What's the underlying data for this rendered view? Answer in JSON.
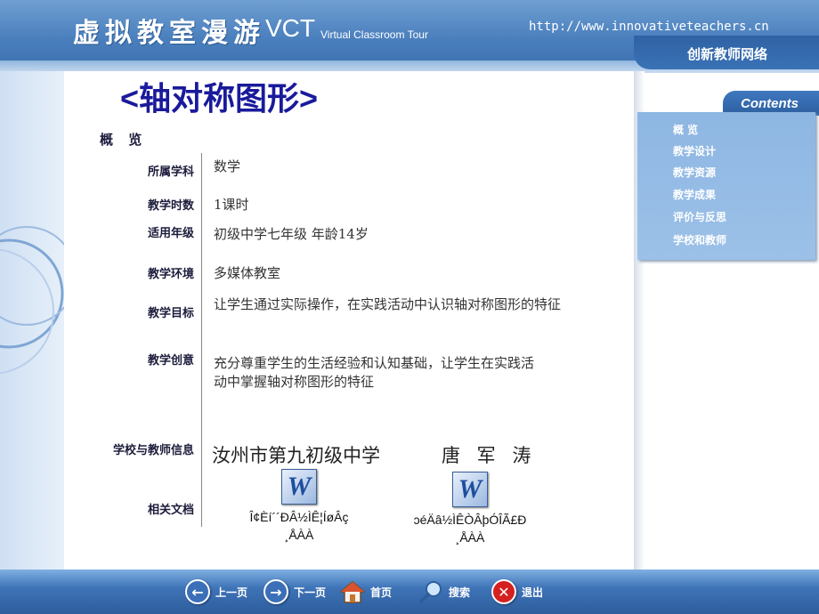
{
  "header": {
    "title_cn": "虚拟教室漫游",
    "title_vct": "VCT",
    "title_en": "Virtual Classroom Tour",
    "url": "http://www.innovativeteachers.cn",
    "network": "创新教师网络"
  },
  "page_title": "<轴对称图形>",
  "overview_label": "概 览",
  "fields": [
    {
      "label": "所属学科",
      "value": "数学"
    },
    {
      "label": "教学时数",
      "value": "1课时"
    },
    {
      "label": "适用年级",
      "value": "初级中学七年级 年龄14岁"
    },
    {
      "label": "教学环境",
      "value": "多媒体教室"
    },
    {
      "label": "教学目标",
      "value": "让学生通过实际操作，在实践活动中认识轴对称图形的特征"
    },
    {
      "label": "教学创意",
      "value_line1": "充分尊重学生的生活经验和认知基础，让学生在实践活",
      "value_line2": "动中掌握轴对称图形的特征"
    },
    {
      "label": "学校与教师信息",
      "school": "汝州市第九初级中学",
      "teacher": "唐 军 涛"
    },
    {
      "label": "相关文档"
    }
  ],
  "documents": [
    {
      "icon": "word-document-icon",
      "glyph": "W",
      "name_line1": "Î¢Èí´´ÐÂ½ÌÊ¦ÍøÂç",
      "name_line2": "¸ÅÀÀ"
    },
    {
      "icon": "word-document-icon",
      "glyph": "W",
      "name_line1": "ɔéÄâ½ÌÊÒÂþÓÎÃ£Ð",
      "name_line2": "¸ÅÀÀ"
    }
  ],
  "contents": {
    "title": "Contents",
    "items": [
      "概 览",
      "教学设计",
      "教学资源",
      "教学成果",
      "评价与反思",
      "学校和教师"
    ]
  },
  "footer": {
    "prev": "上一页",
    "next": "下一页",
    "home": "首页",
    "search": "搜索",
    "exit": "退出"
  },
  "colors": {
    "title_blue": "#1a1a9c",
    "header_blue": "#4a7fbd",
    "panel_blue": "#8db6e2",
    "exit_red": "#d42020"
  }
}
